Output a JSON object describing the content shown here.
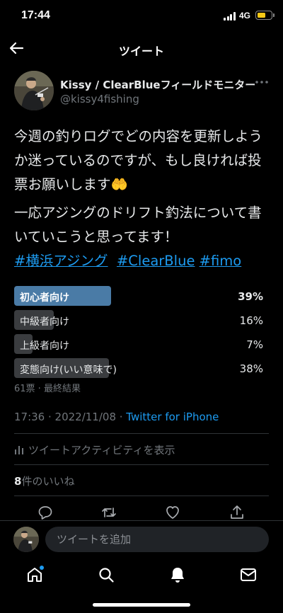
{
  "status_bar": {
    "time": "17:44",
    "network": "4G"
  },
  "header": {
    "title": "ツイート"
  },
  "tweet": {
    "author": {
      "display_name": "Kissy / ClearBlueフィールドモニター",
      "handle": "@kissy4fishing"
    },
    "text_line1": "今週の釣りログでどの内容を更新しようか迷っているのですが、もし良ければ投票お願いします🤲",
    "text_line2": "一応アジングのドリフト釣法について書いていこうと思ってます！",
    "hashtags": [
      "#横浜アジング",
      "#ClearBlue",
      "#fimo"
    ],
    "poll": {
      "options": [
        {
          "label": "初心者向け",
          "percent_text": "39%",
          "percent": 39,
          "winner": true
        },
        {
          "label": "中級者向け",
          "percent_text": "16%",
          "percent": 16,
          "winner": false
        },
        {
          "label": "上級者向け",
          "percent_text": "7%",
          "percent": 7,
          "winner": false
        },
        {
          "label": "変態向け(いい意味で)",
          "percent_text": "38%",
          "percent": 38,
          "winner": false
        }
      ],
      "meta": "61票 · 最終結果"
    },
    "timestamp": "17:36 · 2022/11/08 · ",
    "source": "Twitter for iPhone",
    "activity_label": "ツイートアクティビティを表示",
    "likes_count": "8",
    "likes_label": "件のいいね"
  },
  "reply": {
    "placeholder": "ツイートを追加"
  },
  "colors": {
    "accent": "#1d9bf0",
    "poll_winner": "#4a7ba6",
    "poll_other": "#3a3c3f",
    "battery": "#f5c816"
  },
  "icons": {
    "actions": [
      "reply-icon",
      "retweet-icon",
      "like-icon",
      "share-icon"
    ],
    "tabs": [
      "home-icon",
      "search-icon",
      "notifications-icon",
      "messages-icon"
    ]
  }
}
